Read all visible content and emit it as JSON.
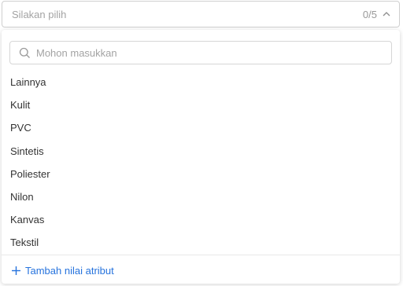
{
  "select": {
    "placeholder": "Silakan pilih",
    "count": "0/5",
    "icon": "chevron-up-icon"
  },
  "dropdown": {
    "search": {
      "placeholder": "Mohon masukkan",
      "value": "",
      "icon": "search-icon"
    },
    "options": [
      "Lainnya",
      "Kulit",
      "PVC",
      "Sintetis",
      "Poliester",
      "Nilon",
      "Kanvas",
      "Tekstil"
    ],
    "footer": {
      "label": "Tambah nilai atribut",
      "icon": "plus-icon"
    }
  },
  "colors": {
    "accent": "#2673dd",
    "text": "#333333",
    "placeholder": "#a3a3a3",
    "border": "#cfcfcf"
  }
}
